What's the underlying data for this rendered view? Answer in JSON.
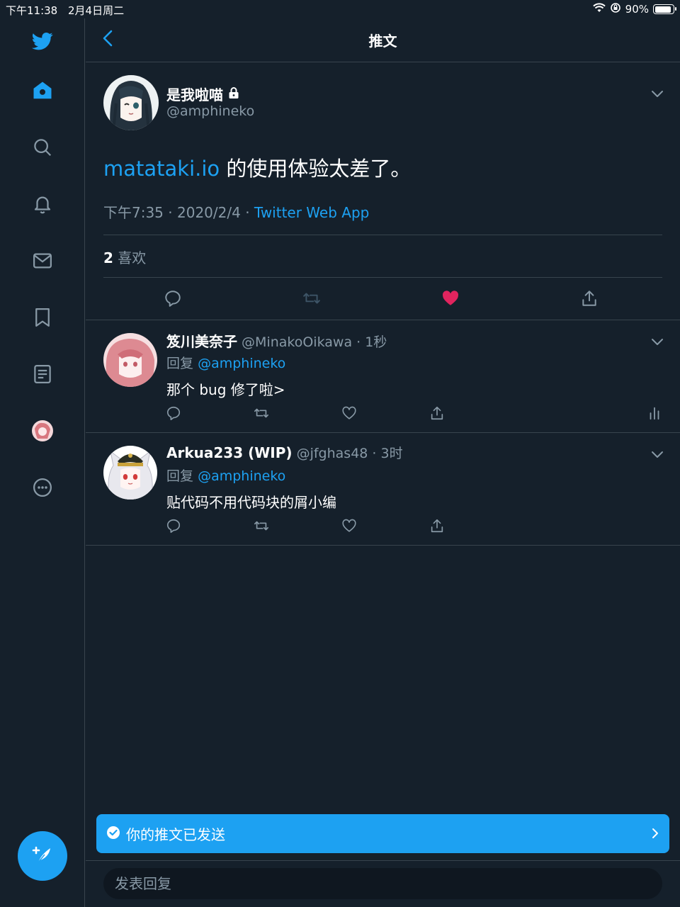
{
  "status_bar": {
    "time": "下午11:38",
    "date": "2月4日周二",
    "battery": "90%",
    "battery_level": 0.9
  },
  "sidebar": {
    "items": [
      {
        "icon": "twitter-logo-icon",
        "active": true
      },
      {
        "icon": "home-icon",
        "active": true
      },
      {
        "icon": "search-icon"
      },
      {
        "icon": "bell-icon"
      },
      {
        "icon": "mail-icon"
      },
      {
        "icon": "bookmark-icon"
      },
      {
        "icon": "list-icon"
      },
      {
        "icon": "profile-avatar"
      },
      {
        "icon": "more-icon"
      }
    ],
    "compose_icon": "compose-feather-icon"
  },
  "header": {
    "title": "推文",
    "back_icon": "chevron-left-icon"
  },
  "tweet": {
    "author_name": "是我啦喵",
    "locked_icon": "lock-icon",
    "author_handle": "@amphineko",
    "body_link": "matataki.io",
    "body_text": " 的使用体验太差了。",
    "time": "下午7:35",
    "date": "2020/2/4",
    "separator": "·",
    "source": "Twitter Web App",
    "likes_count": "2",
    "likes_label": "喜欢",
    "liked": true
  },
  "replies": [
    {
      "name": "笈川美奈子",
      "handle": "@MinakoOikawa",
      "time": "1秒",
      "reply_prefix": "回复",
      "reply_to": "@amphineko",
      "text": "那个 bug 修了啦>",
      "has_analytics": true
    },
    {
      "name": "Arkua233 (WIP)",
      "handle": "@jfghas48",
      "time": "3时",
      "reply_prefix": "回复",
      "reply_to": "@amphineko",
      "text": "贴代码不用代码块的屑小编",
      "has_analytics": false
    }
  ],
  "toast": {
    "message": "你的推文已发送"
  },
  "compose": {
    "placeholder": "发表回复"
  },
  "colors": {
    "background": "#15202b",
    "accent": "#1da1f2",
    "border": "#38444d",
    "secondary_text": "#8899a6",
    "like": "#e0245e"
  }
}
